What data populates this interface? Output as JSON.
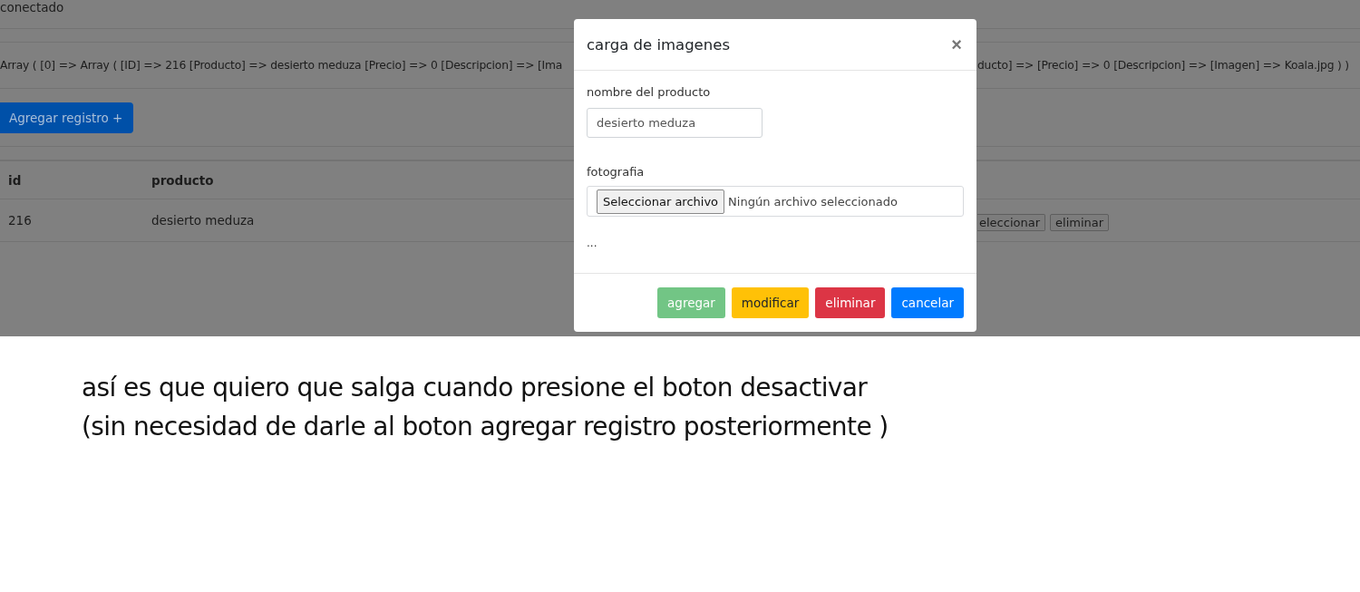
{
  "page": {
    "status": "conectado",
    "array_dump_left": "Array ( [0] => Array ( [ID] => 216 [Producto] => desierto meduza [Precio] => 0 [Descripcion] => [Ima",
    "array_dump_right": "ducto] => [Precio] => 0 [Descripcion] => [Imagen] => Koala.jpg ) )",
    "add_button": "Agregar registro +",
    "table": {
      "columns": [
        "id",
        "producto"
      ],
      "rows": [
        {
          "id": "216",
          "producto": "desierto meduza",
          "actions": [
            "eleccionar",
            "eliminar"
          ]
        }
      ]
    }
  },
  "modal": {
    "title": "carga de imagenes",
    "close": "×",
    "fields": [
      {
        "kind": "text",
        "label": "nombre del producto",
        "value": "desierto meduza"
      },
      {
        "kind": "file",
        "label": "fotografia",
        "button": "Seleccionar archivo",
        "status": "Ningún archivo seleccionado"
      }
    ],
    "note": "...",
    "buttons": [
      {
        "label": "agregar",
        "kind": "add",
        "disabled": true
      },
      {
        "label": "modificar",
        "kind": "edit",
        "disabled": false
      },
      {
        "label": "eliminar",
        "kind": "delete",
        "disabled": false
      },
      {
        "label": "cancelar",
        "kind": "cancel",
        "disabled": false
      }
    ]
  },
  "caption": [
    "así es que quiero que salga cuando presione el boton desactivar",
    "(sin necesidad de darle al boton agregar registro posteriormente )"
  ]
}
